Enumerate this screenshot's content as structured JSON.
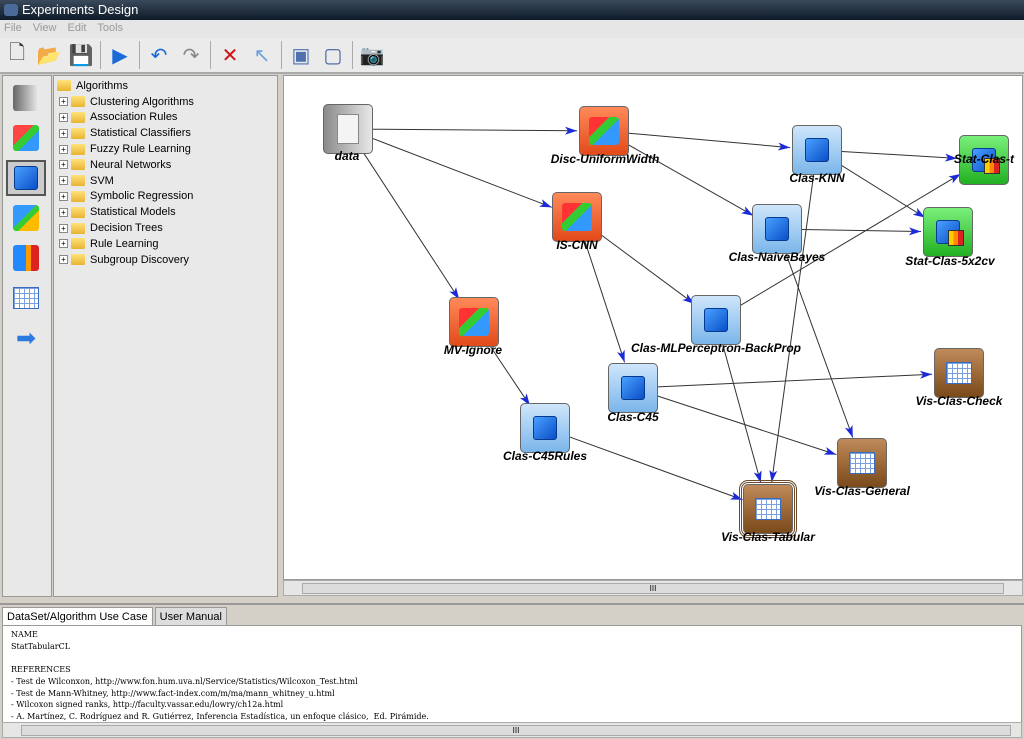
{
  "window": {
    "title": "Experiments Design"
  },
  "menu": [
    "File",
    "View",
    "Edit",
    "Tools"
  ],
  "toolbar": [
    {
      "name": "new-icon",
      "glyph": "🗋",
      "color": "#333"
    },
    {
      "name": "open-icon",
      "glyph": "📂",
      "color": "#d8a820"
    },
    {
      "name": "save-icon",
      "glyph": "💾",
      "color": "#2050b0"
    },
    {
      "name": "run-icon",
      "glyph": "▶",
      "color": "#1a6ad8"
    },
    {
      "name": "undo-icon",
      "glyph": "↶",
      "color": "#1a6ad8"
    },
    {
      "name": "redo-icon",
      "glyph": "↷",
      "color": "#888"
    },
    {
      "name": "delete-icon",
      "glyph": "✕",
      "color": "#d01010"
    },
    {
      "name": "pointer-icon",
      "glyph": "↖",
      "color": "#6aa0e0"
    },
    {
      "name": "snapshot-icon",
      "glyph": "▣",
      "color": "#5070b0"
    },
    {
      "name": "window-icon",
      "glyph": "▢",
      "color": "#4060a0"
    },
    {
      "name": "camera-icon",
      "glyph": "📷",
      "color": "#556"
    }
  ],
  "tree": {
    "root": "Algorithms",
    "items": [
      "Clustering Algorithms",
      "Association Rules",
      "Statistical Classifiers",
      "Fuzzy Rule Learning",
      "Neural Networks",
      "SVM",
      "Symbolic Regression",
      "Statistical Models",
      "Decision Trees",
      "Rule Learning",
      "Subgroup Discovery"
    ]
  },
  "colors": {
    "dataset": "#a8a8a8",
    "preprocess": "#f06a3a",
    "method": "#8cc4f0",
    "test": "#3cd040",
    "visual": "#a06a3a",
    "edge": "#333",
    "arrow": "#1a2ad8"
  },
  "nodes": [
    {
      "id": "data",
      "label": "data",
      "type": "dataset"
    },
    {
      "id": "disc",
      "label": "Disc-UniformWidth",
      "type": "preprocess"
    },
    {
      "id": "iscnn",
      "label": "IS-CNN",
      "type": "preprocess"
    },
    {
      "id": "mv",
      "label": "MV-Ignore",
      "type": "preprocess"
    },
    {
      "id": "knn",
      "label": "Clas-KNN",
      "type": "method"
    },
    {
      "id": "nb",
      "label": "Clas-NaiveBayes",
      "type": "method"
    },
    {
      "id": "mlp",
      "label": "Clas-MLPerceptron-BackProp",
      "type": "method"
    },
    {
      "id": "c45",
      "label": "Clas-C45",
      "type": "method"
    },
    {
      "id": "c45r",
      "label": "Clas-C45Rules",
      "type": "method"
    },
    {
      "id": "statt",
      "label": "Stat-Clas-t",
      "type": "test"
    },
    {
      "id": "stat5",
      "label": "Stat-Clas-5x2cv",
      "type": "test"
    },
    {
      "id": "vcheck",
      "label": "Vis-Clas-Check",
      "type": "visual"
    },
    {
      "id": "vgen",
      "label": "Vis-Clas-General",
      "type": "visual"
    },
    {
      "id": "vtab",
      "label": "Vis-Clas-Tabular",
      "type": "visual",
      "selected": true
    }
  ],
  "edges": [
    [
      "data",
      "disc"
    ],
    [
      "data",
      "iscnn"
    ],
    [
      "data",
      "mv"
    ],
    [
      "disc",
      "knn"
    ],
    [
      "disc",
      "nb"
    ],
    [
      "iscnn",
      "mlp"
    ],
    [
      "iscnn",
      "c45"
    ],
    [
      "mv",
      "c45r"
    ],
    [
      "knn",
      "statt"
    ],
    [
      "knn",
      "stat5"
    ],
    [
      "knn",
      "vtab"
    ],
    [
      "nb",
      "stat5"
    ],
    [
      "nb",
      "vgen"
    ],
    [
      "mlp",
      "statt"
    ],
    [
      "mlp",
      "vtab"
    ],
    [
      "c45",
      "vcheck"
    ],
    [
      "c45",
      "vgen"
    ],
    [
      "c45r",
      "vtab"
    ]
  ],
  "bottom_tabs": [
    "DataSet/Algorithm Use Case",
    "User Manual"
  ],
  "description": "NAME\nStatTabularCL\n\nREFERENCES\n- Test de Wilconxon, http://www.fon.hum.uva.nl/Service/Statistics/Wilcoxon_Test.html\n- Test de Mann-Whitney, http://www.fact-index.com/m/ma/mann_whitney_u.html\n- Wilcoxon signed ranks, http://faculty.vassar.edu/lowry/ch12a.html\n- A. Martínez, C. Rodríguez and R. Gutiérrez, Inferencia Estadística, un enfoque clásico,  Ed. Pirámide.",
  "scroll_grip": "III"
}
